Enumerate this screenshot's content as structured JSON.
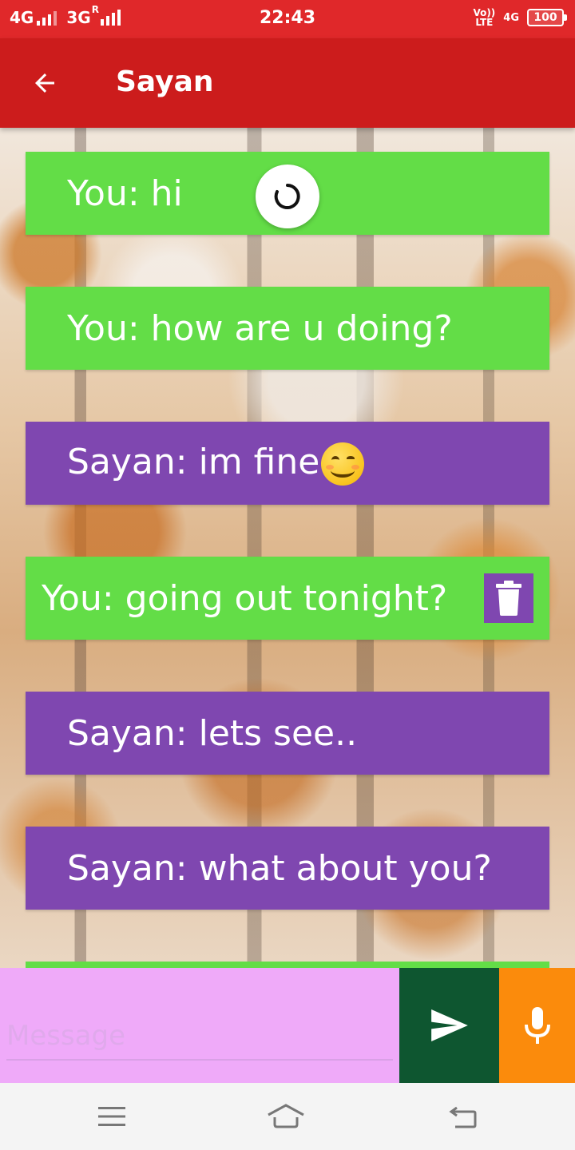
{
  "status_bar": {
    "net1": "4G",
    "net2": "3G",
    "roaming": "R",
    "time": "22:43",
    "volte_top": "Vo))",
    "volte_bottom": "LTE",
    "net3": "4G",
    "battery": "100"
  },
  "header": {
    "title": "Sayan",
    "back_icon": "arrow-left-icon"
  },
  "messages": [
    {
      "sender": "me",
      "text": "You: hi"
    },
    {
      "sender": "me",
      "text": "You: how are u doing?"
    },
    {
      "sender": "them",
      "text": "Sayan: im fine",
      "emoji": "smiling-face-icon"
    },
    {
      "sender": "me",
      "text": "You: going out tonight?",
      "action_icon": "trash-icon"
    },
    {
      "sender": "them",
      "text": "Sayan: lets see.."
    },
    {
      "sender": "them",
      "text": "Sayan: what about you?"
    }
  ],
  "composer": {
    "placeholder": "Message",
    "send_icon": "send-icon",
    "mic_icon": "microphone-icon"
  },
  "navigation": {
    "menu_icon": "menu-icon",
    "home_icon": "home-icon",
    "back_icon": "return-icon"
  },
  "colors": {
    "status_bar": "#e0282a",
    "app_bar": "#cc1c1c",
    "my_bubble": "#63dd47",
    "their_bubble": "#7f47b0",
    "input_bg": "#efaaf9",
    "send_bg": "#0e5630",
    "mic_bg": "#fb8b0c"
  }
}
